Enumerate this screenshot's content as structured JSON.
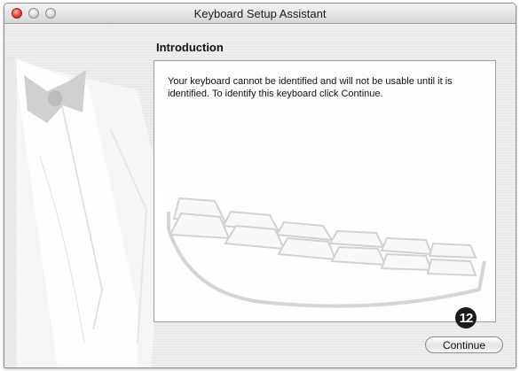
{
  "window": {
    "title": "Keyboard Setup Assistant",
    "controls": [
      "close",
      "minimize",
      "zoom"
    ]
  },
  "page": {
    "section_title": "Introduction",
    "message": "Your keyboard cannot be identified and will not be usable until it is identified. To identify this keyboard click Continue.",
    "callout_number": "12"
  },
  "buttons": {
    "continue_label": "Continue"
  },
  "icons": [
    "keyboard-illustration-icon",
    "tuxedo-illustration"
  ],
  "colors": {
    "close_light": "#e0443a",
    "window_bg": "#ececec",
    "badge": "#1b1b1b"
  }
}
